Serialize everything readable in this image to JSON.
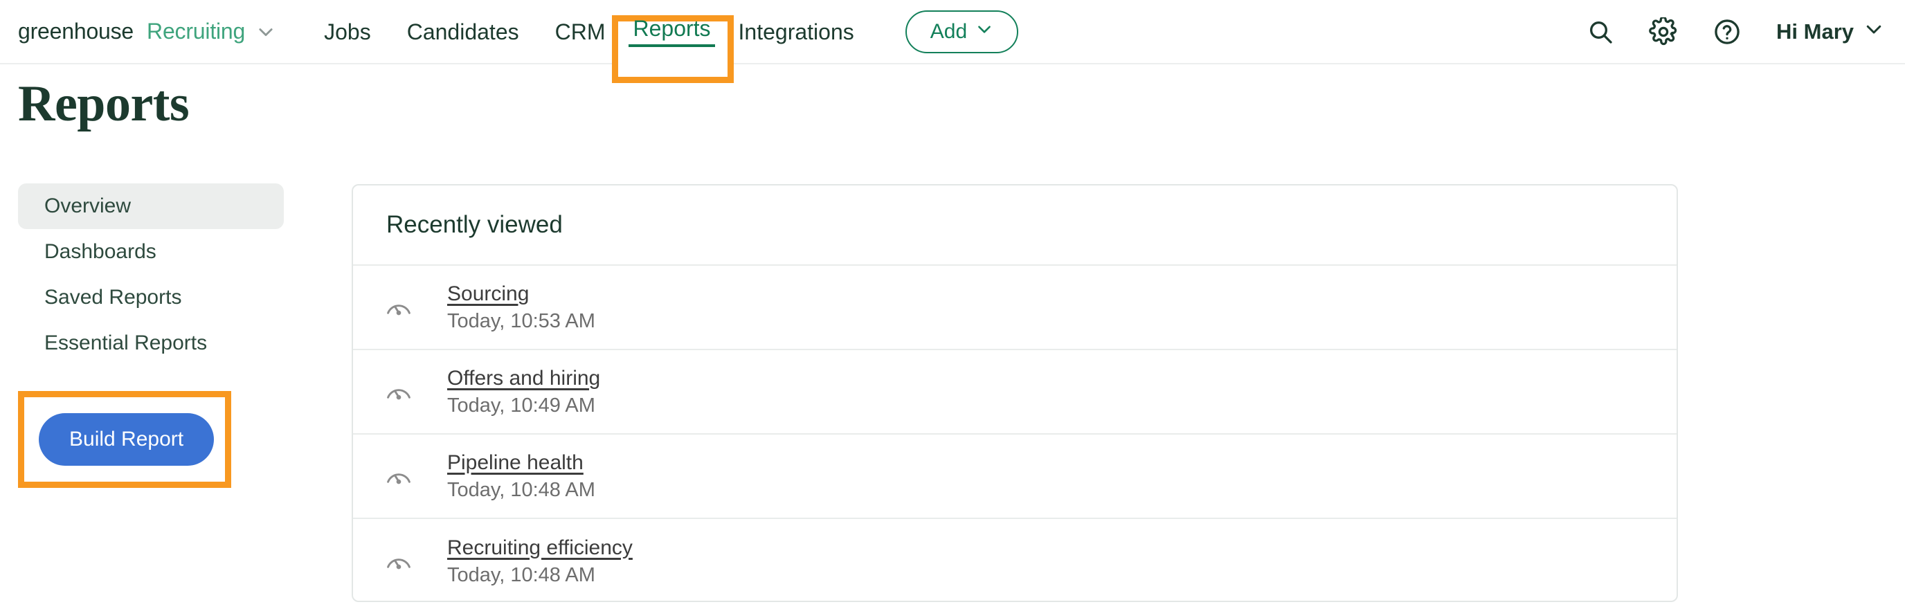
{
  "brand": {
    "name": "greenhouse",
    "product": "Recruiting",
    "chevron_icon": "chevron-down-icon"
  },
  "nav": {
    "items": [
      {
        "label": "Jobs"
      },
      {
        "label": "Candidates"
      },
      {
        "label": "CRM"
      },
      {
        "label": "Reports",
        "active": true,
        "highlighted": true
      },
      {
        "label": "Integrations"
      }
    ],
    "add_button": {
      "label": "Add",
      "chevron_icon": "chevron-down-icon"
    },
    "search_icon": "search-icon",
    "settings_icon": "gear-icon",
    "help_icon": "question-circle-icon",
    "user_menu": {
      "label": "Hi Mary",
      "chevron_icon": "chevron-down-icon"
    }
  },
  "page": {
    "title": "Reports"
  },
  "sidebar": {
    "items": [
      {
        "label": "Overview",
        "active": true
      },
      {
        "label": "Dashboards",
        "active": false
      },
      {
        "label": "Saved Reports",
        "active": false
      },
      {
        "label": "Essential Reports",
        "active": false
      }
    ],
    "build_report_button": {
      "label": "Build Report",
      "highlighted": true
    }
  },
  "card": {
    "header": "Recently viewed",
    "rows": [
      {
        "icon": "gauge-icon",
        "title": "Sourcing",
        "timestamp": "Today, 10:53 AM"
      },
      {
        "icon": "gauge-icon",
        "title": "Offers and hiring",
        "timestamp": "Today, 10:49 AM"
      },
      {
        "icon": "gauge-icon",
        "title": "Pipeline health",
        "timestamp": "Today, 10:48 AM"
      },
      {
        "icon": "gauge-icon",
        "title": "Recruiting efficiency",
        "timestamp": "Today, 10:48 AM"
      }
    ]
  },
  "colors": {
    "brand_green": "#3fa47d",
    "dark_green": "#1c3a2e",
    "link_green": "#127a52",
    "highlight_orange": "#f89820",
    "button_blue": "#3b73d4",
    "border_gray": "#e3e7e6",
    "active_bg": "#eceeed"
  }
}
